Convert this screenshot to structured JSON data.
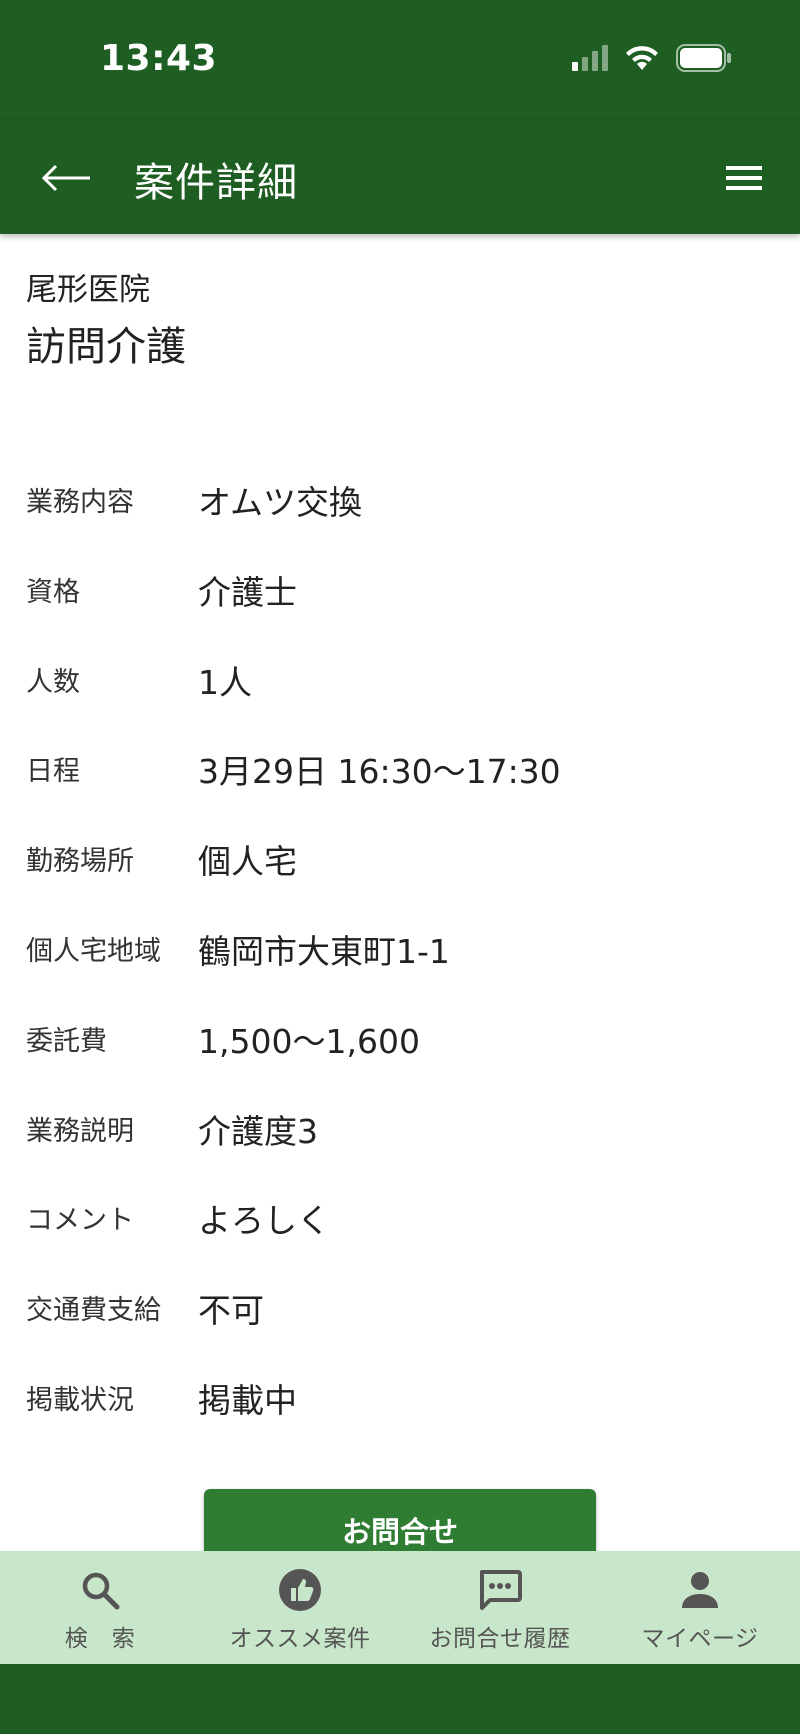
{
  "status_bar": {
    "time": "13:43"
  },
  "app_bar": {
    "title": "案件詳細"
  },
  "job": {
    "facility": "尾形医院",
    "title": "訪問介護",
    "details": [
      {
        "label": "業務内容",
        "value": "オムツ交換"
      },
      {
        "label": "資格",
        "value": "介護士"
      },
      {
        "label": "人数",
        "value": "1人"
      },
      {
        "label": "日程",
        "value": "3月29日 16:30〜17:30"
      },
      {
        "label": "勤務場所",
        "value": "個人宅"
      },
      {
        "label": "個人宅地域",
        "value": "鶴岡市大東町1-1"
      },
      {
        "label": "委託費",
        "value": "1,500〜1,600"
      },
      {
        "label": "業務説明",
        "value": "介護度3"
      },
      {
        "label": "コメント",
        "value": "よろしく"
      },
      {
        "label": "交通費支給",
        "value": "不可"
      },
      {
        "label": "掲載状況",
        "value": "掲載中"
      }
    ]
  },
  "actions": {
    "inquiry_label": "お問合せ"
  },
  "bottom_nav": {
    "items": [
      {
        "label": "検　索",
        "icon": "search-icon"
      },
      {
        "label": "オススメ案件",
        "icon": "thumb-up-icon"
      },
      {
        "label": "お問合せ履歴",
        "icon": "chat-icon"
      },
      {
        "label": "マイページ",
        "icon": "person-icon"
      }
    ]
  },
  "colors": {
    "primary_dark": "#1e5e22",
    "button": "#2e7d32",
    "nav_background": "#c8e6c9"
  }
}
